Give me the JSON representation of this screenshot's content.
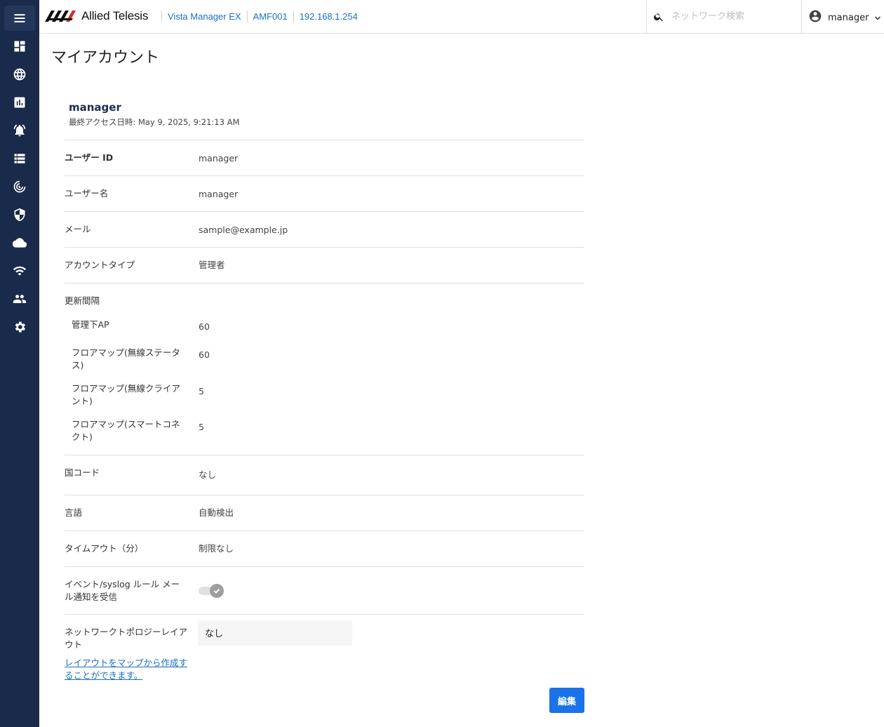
{
  "header": {
    "brand": "Allied Telesis",
    "breadcrumbs": [
      "Vista Manager EX",
      "AMF001",
      "192.168.1.254"
    ],
    "search_placeholder": "ネットワーク検索",
    "user": "manager"
  },
  "sidebar": {
    "icons": [
      "menu-icon",
      "dashboard-icon",
      "globe-icon",
      "chart-icon",
      "alarm-icon",
      "list-icon",
      "radar-icon",
      "shield-icon",
      "cloud-icon",
      "wifi-icon",
      "people-icon",
      "gear-icon"
    ]
  },
  "page": {
    "title": "マイアカウント"
  },
  "profile": {
    "name": "manager",
    "last_access": "最終アクセス日時: May 9, 2025, 9:21:13 AM"
  },
  "fields": {
    "user_id": {
      "label": "ユーザー ID",
      "value": "manager"
    },
    "user_name": {
      "label": "ユーザー名",
      "value": "manager"
    },
    "email": {
      "label": "メール",
      "value": "sample@example.jp"
    },
    "account_type": {
      "label": "アカウントタイプ",
      "value": "管理者"
    },
    "refresh": {
      "label": "更新間隔",
      "items": [
        {
          "label": "管理下AP",
          "value": "60"
        },
        {
          "label": "フロアマップ(無線ステータス)",
          "value": "60"
        },
        {
          "label": "フロアマップ(無線クライアント)",
          "value": "5"
        },
        {
          "label": "フロアマップ(スマートコネクト)",
          "value": "5"
        }
      ]
    },
    "country_code": {
      "label": "国コード",
      "value": "なし"
    },
    "language": {
      "label": "言語",
      "value": "自動検出"
    },
    "timeout": {
      "label": "タイムアウト（分）",
      "value": "制限なし"
    },
    "event_mail": {
      "label": "イベント/syslog ルール メール通知を受信",
      "checked": true
    },
    "topology_layout": {
      "label": "ネットワークトポロジーレイアウト",
      "value": "なし",
      "link": "レイアウトをマップから作成することができます。"
    }
  },
  "actions": {
    "edit": "編集"
  },
  "colors": {
    "sidebar": "#1a2a4a",
    "accent": "#1a73e8",
    "link": "#1a6fc0"
  }
}
